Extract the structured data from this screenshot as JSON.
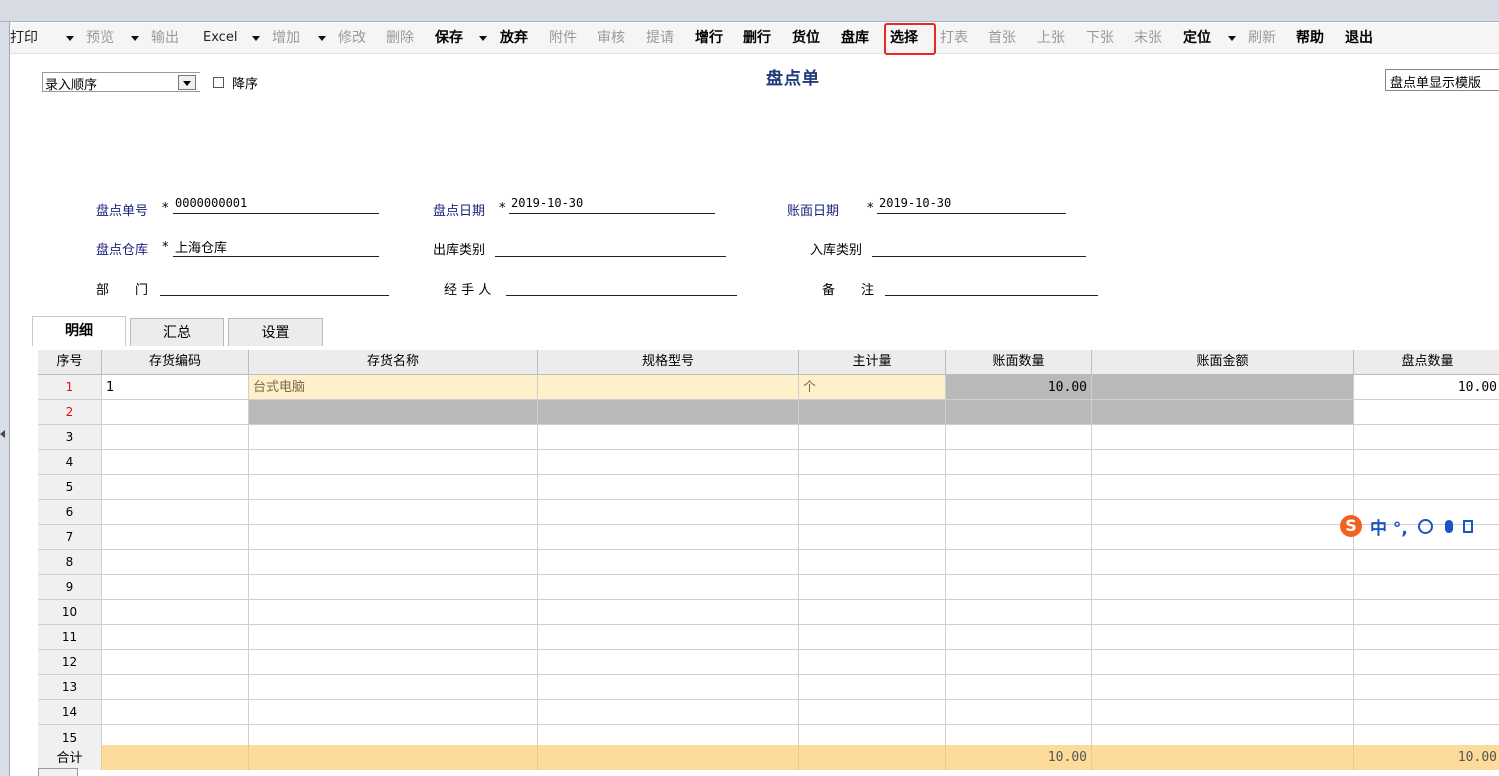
{
  "toolbar": {
    "print": "打印",
    "preview": "预览",
    "output": "输出",
    "excel": "Excel",
    "add": "增加",
    "modify": "修改",
    "delete": "删除",
    "save": "保存",
    "discard": "放弃",
    "attachment": "附件",
    "audit": "审核",
    "submit": "提请",
    "add_row": "增行",
    "del_row": "删行",
    "location": "货位",
    "inventory_wh": "盘库",
    "select": "选择",
    "print_form": "打表",
    "first": "首张",
    "prev": "上张",
    "next": "下张",
    "last": "末张",
    "locate": "定位",
    "refresh": "刷新",
    "help": "帮助",
    "exit": "退出"
  },
  "sort": {
    "value": "录入顺序",
    "descending_label": "降序"
  },
  "title": "盘点单",
  "template": "盘点单显示模版",
  "form": {
    "doc_no_label": "盘点单号",
    "doc_no": "0000000001",
    "date_label": "盘点日期",
    "date": "2019-10-30",
    "book_date_label": "账面日期",
    "book_date": "2019-10-30",
    "warehouse_label": "盘点仓库",
    "warehouse": "上海仓库",
    "out_type_label": "出库类别",
    "in_type_label": "入库类别",
    "dept_label": "部　　门",
    "handler_label": "经 手 人",
    "remark_label": "备　　注",
    "required_mark": "*"
  },
  "tabs": [
    "明细",
    "汇总",
    "设置"
  ],
  "grid": {
    "headers": [
      "序号",
      "存货编码",
      "存货名称",
      "规格型号",
      "主计量",
      "账面数量",
      "账面金额",
      "盘点数量"
    ],
    "rows": [
      [
        "1",
        "1",
        "台式电脑",
        "",
        "个",
        "10.00",
        "",
        "10.00"
      ],
      [
        "2",
        "",
        "",
        "",
        "",
        "",
        "",
        ""
      ],
      [
        "3",
        "",
        "",
        "",
        "",
        "",
        "",
        ""
      ],
      [
        "4",
        "",
        "",
        "",
        "",
        "",
        "",
        ""
      ],
      [
        "5",
        "",
        "",
        "",
        "",
        "",
        "",
        ""
      ],
      [
        "6",
        "",
        "",
        "",
        "",
        "",
        "",
        ""
      ],
      [
        "7",
        "",
        "",
        "",
        "",
        "",
        "",
        ""
      ],
      [
        "8",
        "",
        "",
        "",
        "",
        "",
        "",
        ""
      ],
      [
        "9",
        "",
        "",
        "",
        "",
        "",
        "",
        ""
      ],
      [
        "10",
        "",
        "",
        "",
        "",
        "",
        "",
        ""
      ],
      [
        "11",
        "",
        "",
        "",
        "",
        "",
        "",
        ""
      ],
      [
        "12",
        "",
        "",
        "",
        "",
        "",
        "",
        ""
      ],
      [
        "13",
        "",
        "",
        "",
        "",
        "",
        "",
        ""
      ],
      [
        "14",
        "",
        "",
        "",
        "",
        "",
        "",
        ""
      ]
    ],
    "last_row_no": "15",
    "total_label": "合计",
    "total_book_qty": "10.00",
    "total_count_qty": "10.00"
  },
  "ime": {
    "logo": "S",
    "text": "中 °,",
    "icons": [
      "smiley-icon",
      "microphone-icon",
      "keyboard-icon"
    ]
  }
}
